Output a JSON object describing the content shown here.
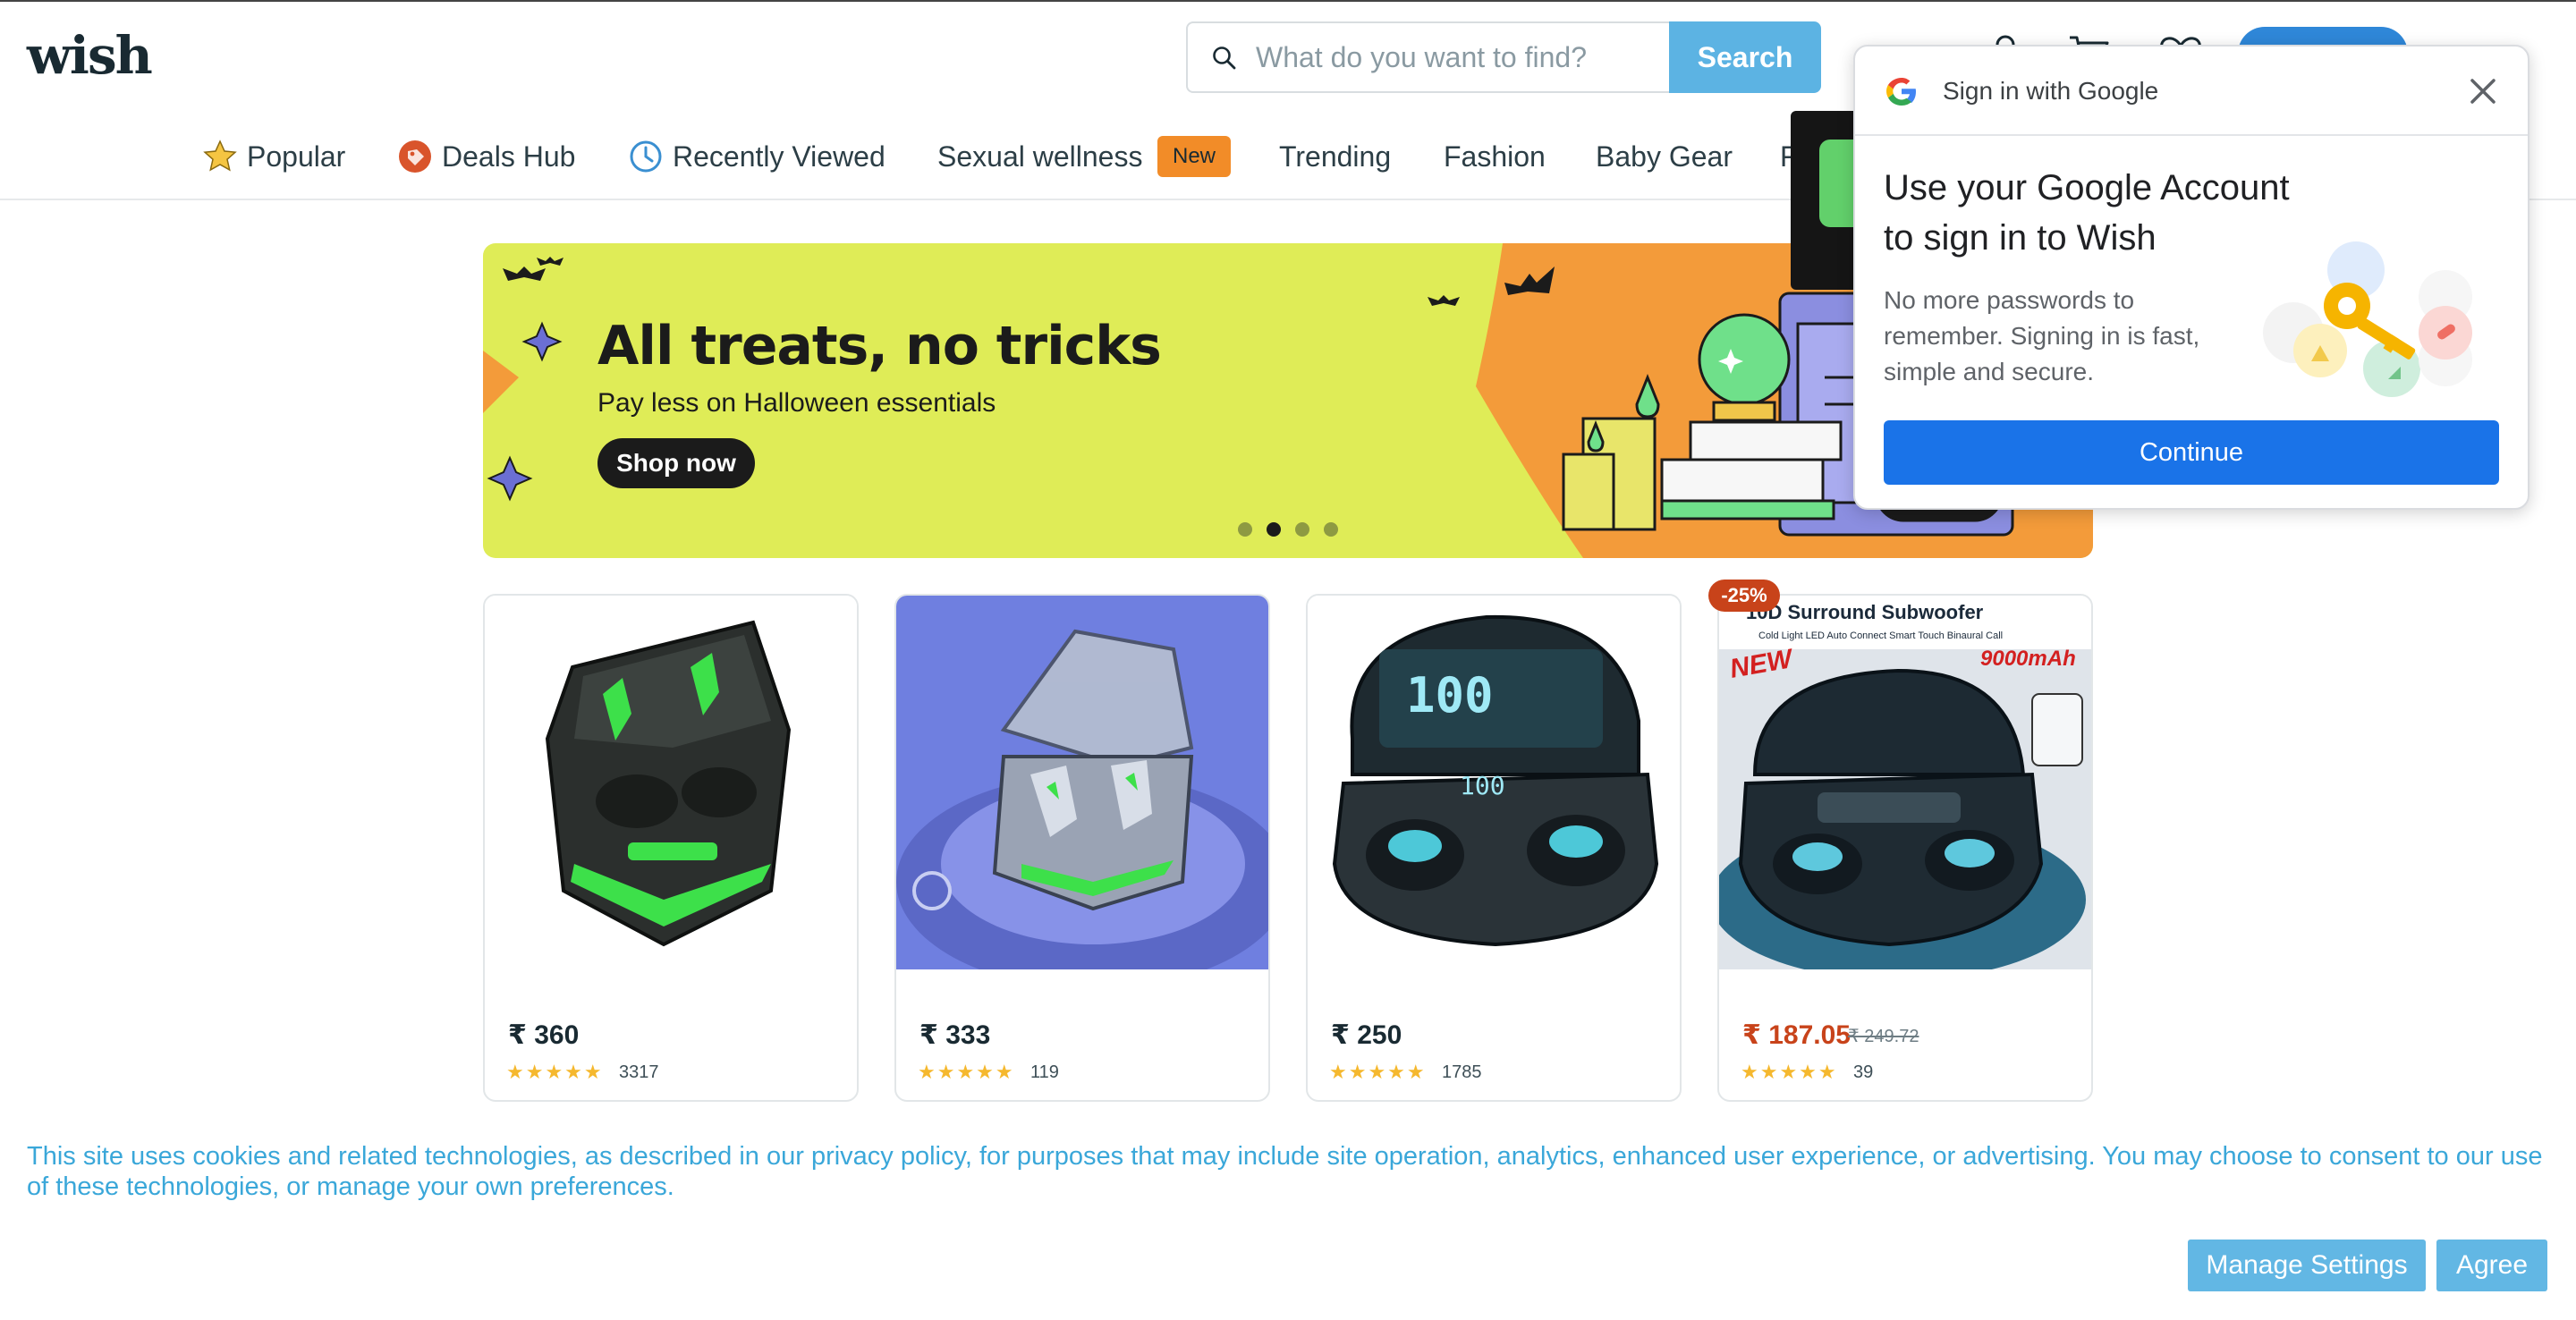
{
  "header": {
    "logo": "wish",
    "search_placeholder": "What do you want to find?",
    "search_button": "Search"
  },
  "nav": {
    "items": [
      {
        "label": "Popular",
        "icon": "star-icon"
      },
      {
        "label": "Deals Hub",
        "icon": "tag-icon"
      },
      {
        "label": "Recently Viewed",
        "icon": "clock-icon"
      },
      {
        "label": "Sexual wellness",
        "icon": ""
      },
      {
        "label": "Trending",
        "icon": ""
      },
      {
        "label": "Fashion",
        "icon": ""
      },
      {
        "label": "Baby Gear",
        "icon": ""
      },
      {
        "label": "F",
        "icon": ""
      }
    ],
    "new_badge": "New"
  },
  "banner": {
    "title": "All treats, no tricks",
    "subtitle": "Pay less on Halloween essentials",
    "cta": "Shop now",
    "active_slide": 2,
    "slide_count": 4
  },
  "products": [
    {
      "price": "₹ 360",
      "old_price": "",
      "discount": "",
      "rating": 4.5,
      "reviews": "3317"
    },
    {
      "price": "₹ 333",
      "old_price": "",
      "discount": "",
      "rating": 4.5,
      "reviews": "119"
    },
    {
      "price": "₹ 250",
      "old_price": "",
      "discount": "",
      "rating": 4.5,
      "reviews": "1785"
    },
    {
      "price": "₹ 187.05",
      "old_price": "₹ 249.72",
      "discount": "-25%",
      "rating": 4.5,
      "reviews": "39",
      "image_text": {
        "headline": "10D Surround Subwoofer",
        "line": "Cold Light LED Auto Connect Smart Touch Binaural Call",
        "new": "NEW",
        "battery": "9000mAh"
      }
    }
  ],
  "cookie": {
    "text": "This site uses cookies and related technologies, as described in our privacy policy, for purposes that may include site operation, analytics, enhanced user experience, or advertising. You may choose to consent to our use of these technologies, or manage your own preferences.",
    "manage": "Manage Settings",
    "agree": "Agree"
  },
  "google_popup": {
    "title": "Sign in with Google",
    "heading": "Use your Google Account to sign in to Wish",
    "body": "No more passwords to remember. Signing in is fast, simple and secure.",
    "continue": "Continue"
  },
  "colors": {
    "brand": "#192a32",
    "search_button": "#5cb3e3",
    "banner_bg": "#dfec57",
    "banner_accent": "#f39b3a",
    "sale": "#c8431a",
    "google_blue": "#1a73e8",
    "cookie_text": "#3aa7d9"
  }
}
